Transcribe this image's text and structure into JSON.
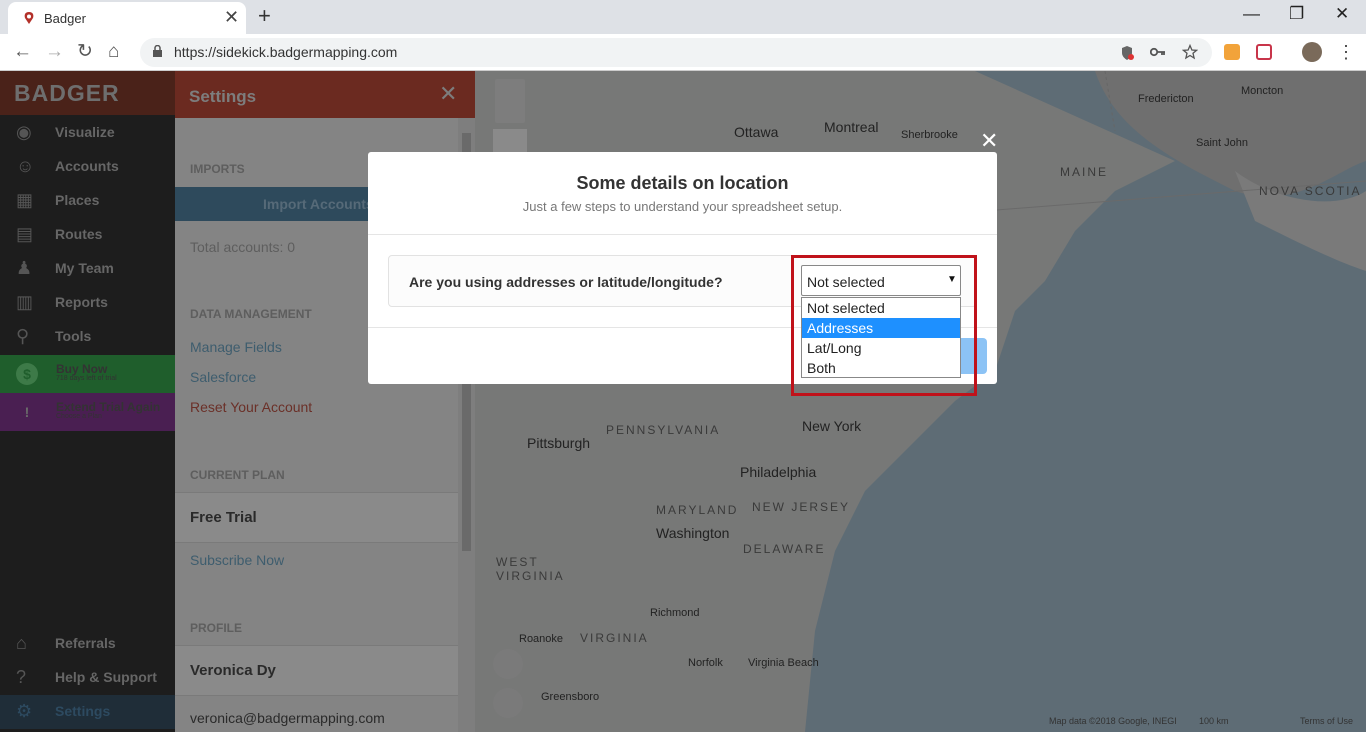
{
  "browser": {
    "tab_title": "Badger",
    "tab_close": "✕",
    "new_tab": "+",
    "minimize": "—",
    "restore": "❐",
    "close": "✕",
    "back": "←",
    "forward": "→",
    "reload": "↻",
    "home": "⌂",
    "url": "https://sidekick.badgermapping.com",
    "menu": "⋮"
  },
  "sidebar": {
    "logo": "BADGER",
    "items": [
      {
        "label": "Visualize",
        "icon": "eye-icon",
        "glyph": "◉"
      },
      {
        "label": "Accounts",
        "icon": "person-icon",
        "glyph": "☺"
      },
      {
        "label": "Places",
        "icon": "store-icon",
        "glyph": "▦"
      },
      {
        "label": "Routes",
        "icon": "map-icon",
        "glyph": "▤"
      },
      {
        "label": "My Team",
        "icon": "team-icon",
        "glyph": "♟"
      },
      {
        "label": "Reports",
        "icon": "report-icon",
        "glyph": "▥"
      },
      {
        "label": "Tools",
        "icon": "pin-icon",
        "glyph": "⚲"
      }
    ],
    "buy_now": {
      "title": "Buy Now",
      "subtitle": "718 days left of trial",
      "glyph": "$"
    },
    "extend": {
      "title": "Extend Trial Again",
      "subtitle": "Choose a Plan",
      "glyph": "!"
    },
    "bottom_items": [
      {
        "label": "Referrals",
        "icon": "gift-icon",
        "glyph": "⌂"
      },
      {
        "label": "Help & Support",
        "icon": "help-icon",
        "glyph": "?"
      },
      {
        "label": "Settings",
        "icon": "gear-icon",
        "glyph": "⚙"
      }
    ]
  },
  "settings": {
    "title": "Settings",
    "close": "✕",
    "imports_head": "IMPORTS",
    "import_button": "Import Accounts",
    "total_accounts": "Total accounts: 0",
    "data_head": "DATA MANAGEMENT",
    "manage_fields": "Manage Fields",
    "salesforce": "Salesforce",
    "reset": "Reset Your Account",
    "plan_head": "CURRENT PLAN",
    "plan": "Free Trial",
    "subscribe": "Subscribe Now",
    "profile_head": "PROFILE",
    "profile_name": "Veronica Dy",
    "profile_email": "veronica@badgermapping.com"
  },
  "map": {
    "labels": {
      "ottawa": "Ottawa",
      "montreal": "Montreal",
      "sherbrooke": "Sherbrooke",
      "fredericton": "Fredericton",
      "moncton": "Moncton",
      "saint_john": "Saint John",
      "maine": "MAINE",
      "nova_scotia": "NOVA SCOTIA",
      "pennsylvania": "PENNSYLVANIA",
      "pittsburgh": "Pittsburgh",
      "new_york": "New York",
      "philadelphia": "Philadelphia",
      "maryland": "MARYLAND",
      "new_jersey": "NEW JERSEY",
      "washington": "Washington",
      "delaware": "DELAWARE",
      "west_virginia_1": "WEST",
      "west_virginia_2": "VIRGINIA",
      "richmond": "Richmond",
      "roanoke": "Roanoke",
      "virginia": "VIRGINIA",
      "norfolk": "Norfolk",
      "virginia_beach": "Virginia Beach",
      "greensboro": "Greensboro"
    },
    "footer": {
      "map_data": "Map data ©2018 Google, INEGI",
      "scale": "100 km",
      "terms": "Terms of Use"
    }
  },
  "modal": {
    "close": "✕",
    "title": "Some details on location",
    "subtitle": "Just a few steps to understand your spreadsheet setup.",
    "question": "Are you using addresses or latitude/longitude?",
    "select_value": "Not selected",
    "select_arrow": "▼",
    "options": [
      "Not selected",
      "Addresses",
      "Lat/Long",
      "Both"
    ],
    "selected_index": 1
  }
}
